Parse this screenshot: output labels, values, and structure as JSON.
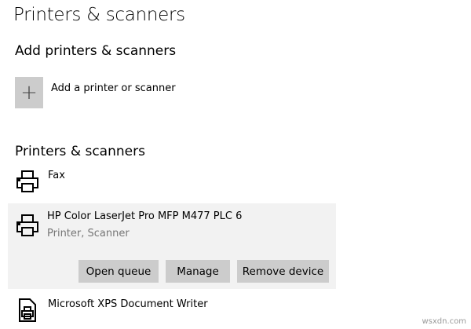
{
  "page_title": "Printers & scanners",
  "add_section": {
    "heading": "Add printers & scanners",
    "button_label": "Add a printer or scanner"
  },
  "list_section": {
    "heading": "Printers & scanners",
    "devices": [
      {
        "name": "Fax"
      },
      {
        "name": "HP Color LaserJet Pro MFP M477 PLC 6",
        "subtitle": "Printer, Scanner",
        "buttons": [
          "Open queue",
          "Manage",
          "Remove device"
        ]
      },
      {
        "name": "Microsoft XPS Document Writer"
      }
    ]
  },
  "watermark": "wsxdn.com"
}
